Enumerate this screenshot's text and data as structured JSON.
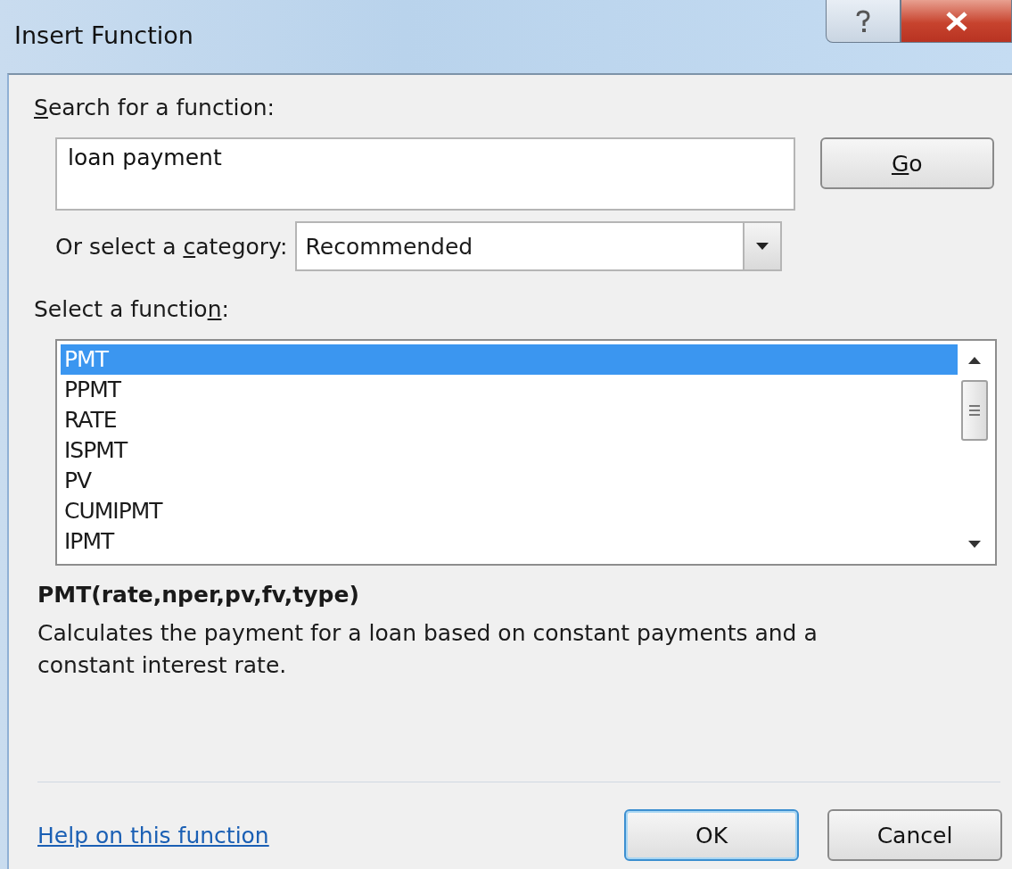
{
  "window": {
    "title": "Insert Function"
  },
  "search": {
    "label": {
      "key": "S",
      "post": "earch for a function:"
    },
    "value": "loan payment",
    "go_button": {
      "key": "G",
      "post": "o"
    }
  },
  "category": {
    "label": {
      "pre": "Or select a ",
      "key": "c",
      "post": "ategory:"
    },
    "value": "Recommended"
  },
  "functions": {
    "label": {
      "pre": "Select a functio",
      "key": "n",
      "post": ":"
    },
    "items": [
      {
        "name": "PMT",
        "selected": true
      },
      {
        "name": "PPMT",
        "selected": false
      },
      {
        "name": "RATE",
        "selected": false
      },
      {
        "name": "ISPMT",
        "selected": false
      },
      {
        "name": "PV",
        "selected": false
      },
      {
        "name": "CUMIPMT",
        "selected": false
      },
      {
        "name": "IPMT",
        "selected": false
      }
    ]
  },
  "signature": "PMT(rate,nper,pv,fv,type)",
  "description": "Calculates the payment for a loan based on constant payments and a constant interest rate.",
  "help_link": "Help on this function",
  "buttons": [
    {
      "label": "OK",
      "default": true
    },
    {
      "label": "Cancel",
      "default": false
    }
  ]
}
